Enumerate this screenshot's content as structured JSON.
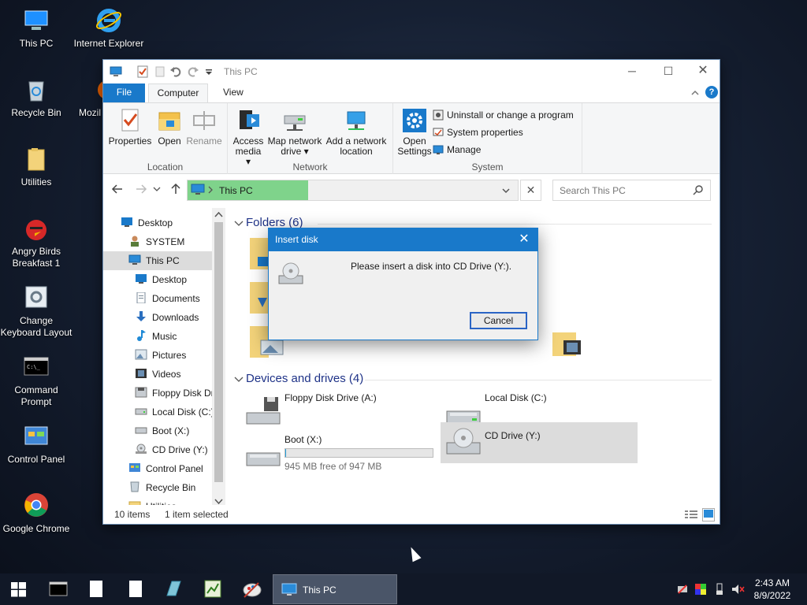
{
  "desktop": {
    "icons": [
      {
        "label": "This PC",
        "icon": "this-pc-icon"
      },
      {
        "label": "Internet Explorer",
        "icon": "internet-explorer-icon"
      },
      {
        "label": "Recycle Bin",
        "icon": "recycle-bin-icon"
      },
      {
        "label": "Mozil",
        "icon": "firefox-icon"
      },
      {
        "label": "Utilities",
        "icon": "folder-icon"
      },
      {
        "label": "Angry Birds Breakfast 1",
        "icon": "angry-birds-icon"
      },
      {
        "label": "Change Keyboard Layout",
        "icon": "keyboard-layout-icon"
      },
      {
        "label": "Command Prompt",
        "icon": "command-prompt-icon"
      },
      {
        "label": "Control Panel",
        "icon": "control-panel-icon"
      },
      {
        "label": "Google Chrome",
        "icon": "chrome-icon"
      }
    ]
  },
  "explorer": {
    "title": "This PC",
    "tabs": {
      "file": "File",
      "computer": "Computer",
      "view": "View"
    },
    "ribbon": {
      "location": {
        "label": "Location",
        "properties": "Properties",
        "open": "Open",
        "rename": "Rename"
      },
      "network": {
        "label": "Network",
        "access_media": "Access media ▾",
        "map_network_drive": "Map network drive ▾",
        "add_network_location": "Add a network location"
      },
      "system": {
        "label": "System",
        "open_settings": "Open Settings",
        "uninstall": "Uninstall or change a program",
        "system_properties": "System properties",
        "manage": "Manage"
      }
    },
    "address": "This PC",
    "search_placeholder": "Search This PC",
    "nav_items": [
      {
        "label": "Desktop",
        "icon": "desktop-icon"
      },
      {
        "label": "SYSTEM",
        "icon": "user-icon"
      },
      {
        "label": "This PC",
        "icon": "this-pc-icon"
      },
      {
        "label": "Desktop",
        "icon": "desktop-icon"
      },
      {
        "label": "Documents",
        "icon": "documents-icon"
      },
      {
        "label": "Downloads",
        "icon": "downloads-icon"
      },
      {
        "label": "Music",
        "icon": "music-icon"
      },
      {
        "label": "Pictures",
        "icon": "pictures-icon"
      },
      {
        "label": "Videos",
        "icon": "videos-icon"
      },
      {
        "label": "Floppy Disk Dri",
        "icon": "floppy-icon"
      },
      {
        "label": "Local Disk (C:)",
        "icon": "local-disk-icon"
      },
      {
        "label": "Boot (X:)",
        "icon": "drive-icon"
      },
      {
        "label": "CD Drive (Y:)",
        "icon": "cd-drive-icon"
      },
      {
        "label": "Control Panel",
        "icon": "control-panel-icon"
      },
      {
        "label": "Recycle Bin",
        "icon": "recycle-bin-icon"
      },
      {
        "label": "Utilities",
        "icon": "folder-icon"
      }
    ],
    "folders_header": "Folders (6)",
    "devices_header": "Devices and drives (4)",
    "drives": [
      {
        "name": "Floppy Disk Drive (A:)",
        "icon": "floppy-drive-icon"
      },
      {
        "name": "Local Disk (C:)",
        "icon": "hard-drive-icon"
      },
      {
        "name": "Boot (X:)",
        "icon": "hard-drive-icon",
        "free_text": "945 MB free of 947 MB",
        "used_fraction": 0.002
      },
      {
        "name": "CD Drive (Y:)",
        "icon": "cd-drive-icon"
      }
    ],
    "status": {
      "items": "10 items",
      "selected": "1 item selected"
    }
  },
  "dialog": {
    "title": "Insert disk",
    "message": "Please insert a disk into CD Drive (Y:).",
    "cancel": "Cancel"
  },
  "taskbar": {
    "active_window": "This PC",
    "time": "2:43 AM",
    "date": "8/9/2022"
  },
  "colors": {
    "accent": "#1979ca",
    "address_highlight": "#7fd38b",
    "taskbar": "#111827"
  }
}
